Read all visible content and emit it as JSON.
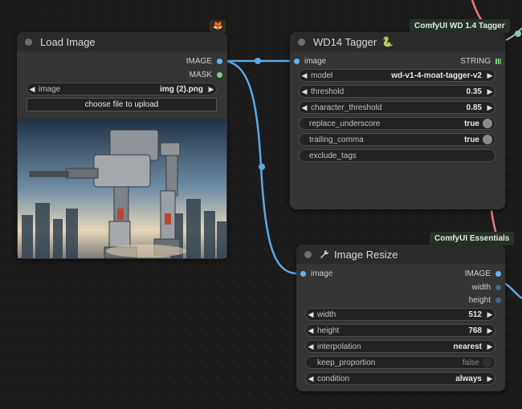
{
  "load_image": {
    "title": "Load Image",
    "badge": "🦊",
    "outputs": [
      "IMAGE",
      "MASK"
    ],
    "image_widget": {
      "label": "image",
      "value": "img (2).png"
    },
    "upload_label": "choose file to upload"
  },
  "tagger": {
    "title": "WD14 Tagger",
    "title_icon": "🐍",
    "badge": "ComfyUI WD 1.4 Tagger",
    "input": "image",
    "output": "STRING",
    "widgets": [
      {
        "label": "model",
        "value": "wd-v1-4-moat-tagger-v2"
      },
      {
        "label": "threshold",
        "value": "0.35"
      },
      {
        "label": "character_threshold",
        "value": "0.85"
      }
    ],
    "toggles": [
      {
        "label": "replace_underscore",
        "value": "true"
      },
      {
        "label": "trailing_comma",
        "value": "true"
      }
    ],
    "exclude_tags_label": "exclude_tags"
  },
  "resize": {
    "title": "Image Resize",
    "title_icon": "wrench-icon",
    "badge": "ComfyUI Essentials",
    "input": "image",
    "outputs": [
      "IMAGE",
      "width",
      "height"
    ],
    "widgets": [
      {
        "label": "width",
        "value": "512"
      },
      {
        "label": "height",
        "value": "768"
      },
      {
        "label": "interpolation",
        "value": "nearest"
      }
    ],
    "toggle": {
      "label": "keep_proportion",
      "value": "false"
    },
    "condition": {
      "label": "condition",
      "value": "always"
    }
  },
  "colors": {
    "wire_image": "#5aa9e6",
    "wire_string": "#f07a7a",
    "wire_int": "#8fc6b0",
    "node_bg": "#353535",
    "title_bg": "#2b2b2b",
    "badge_bg": "#263326"
  }
}
